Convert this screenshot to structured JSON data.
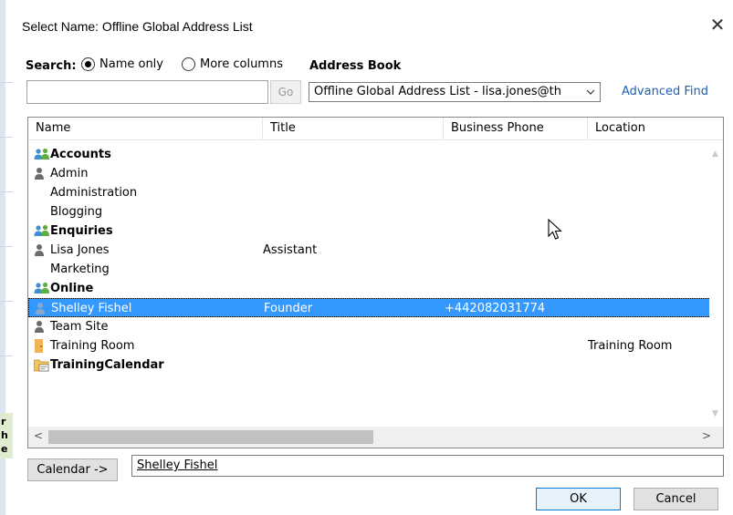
{
  "dialog": {
    "title": "Select Name: Offline Global Address List",
    "close_icon": "close-icon"
  },
  "search": {
    "label": "Search:",
    "options": [
      "Name only",
      "More columns"
    ],
    "selected": "Name only",
    "input_value": "",
    "go_label": "Go"
  },
  "address_book": {
    "label": "Address Book",
    "selected": "Offline Global Address List - lisa.jones@th",
    "advanced_find": "Advanced Find"
  },
  "list": {
    "columns": [
      "Name",
      "Title",
      "Business Phone",
      "Location"
    ],
    "rows": [
      {
        "name": "Accounts",
        "title": "",
        "phone": "",
        "location": "",
        "icon": "group-icon",
        "bold": true,
        "selected": false
      },
      {
        "name": "Admin",
        "title": "",
        "phone": "",
        "location": "",
        "icon": "user-icon",
        "bold": false,
        "selected": false
      },
      {
        "name": "Administration",
        "title": "",
        "phone": "",
        "location": "",
        "icon": "",
        "bold": false,
        "selected": false
      },
      {
        "name": "Blogging",
        "title": "",
        "phone": "",
        "location": "",
        "icon": "",
        "bold": false,
        "selected": false
      },
      {
        "name": "Enquiries",
        "title": "",
        "phone": "",
        "location": "",
        "icon": "group-icon",
        "bold": true,
        "selected": false
      },
      {
        "name": "Lisa Jones",
        "title": "Assistant",
        "phone": "",
        "location": "",
        "icon": "user-icon",
        "bold": false,
        "selected": false
      },
      {
        "name": "Marketing",
        "title": "",
        "phone": "",
        "location": "",
        "icon": "",
        "bold": false,
        "selected": false
      },
      {
        "name": "Online",
        "title": "",
        "phone": "",
        "location": "",
        "icon": "group-icon",
        "bold": true,
        "selected": false
      },
      {
        "name": "Shelley Fishel",
        "title": "Founder",
        "phone": "+442082031774",
        "location": "",
        "icon": "user-icon",
        "bold": false,
        "selected": true
      },
      {
        "name": "Team Site",
        "title": "",
        "phone": "",
        "location": "",
        "icon": "user-icon",
        "bold": false,
        "selected": false
      },
      {
        "name": "Training Room",
        "title": "",
        "phone": "",
        "location": "Training Room",
        "icon": "room-icon",
        "bold": false,
        "selected": false
      },
      {
        "name": "TrainingCalendar",
        "title": "",
        "phone": "",
        "location": "",
        "icon": "public-folder-icon",
        "bold": true,
        "selected": false
      }
    ]
  },
  "footer": {
    "calendar_button": "Calendar ->",
    "calendar_value": "Shelley Fishel",
    "ok_label": "OK",
    "cancel_label": "Cancel"
  },
  "colors": {
    "selection": "#3399ff",
    "link": "#1e5fb5",
    "group_icon_blue": "#3f8fcf",
    "group_icon_green": "#5fae3f",
    "user_icon": "#6b6b6b",
    "room_icon": "#f0b457"
  }
}
